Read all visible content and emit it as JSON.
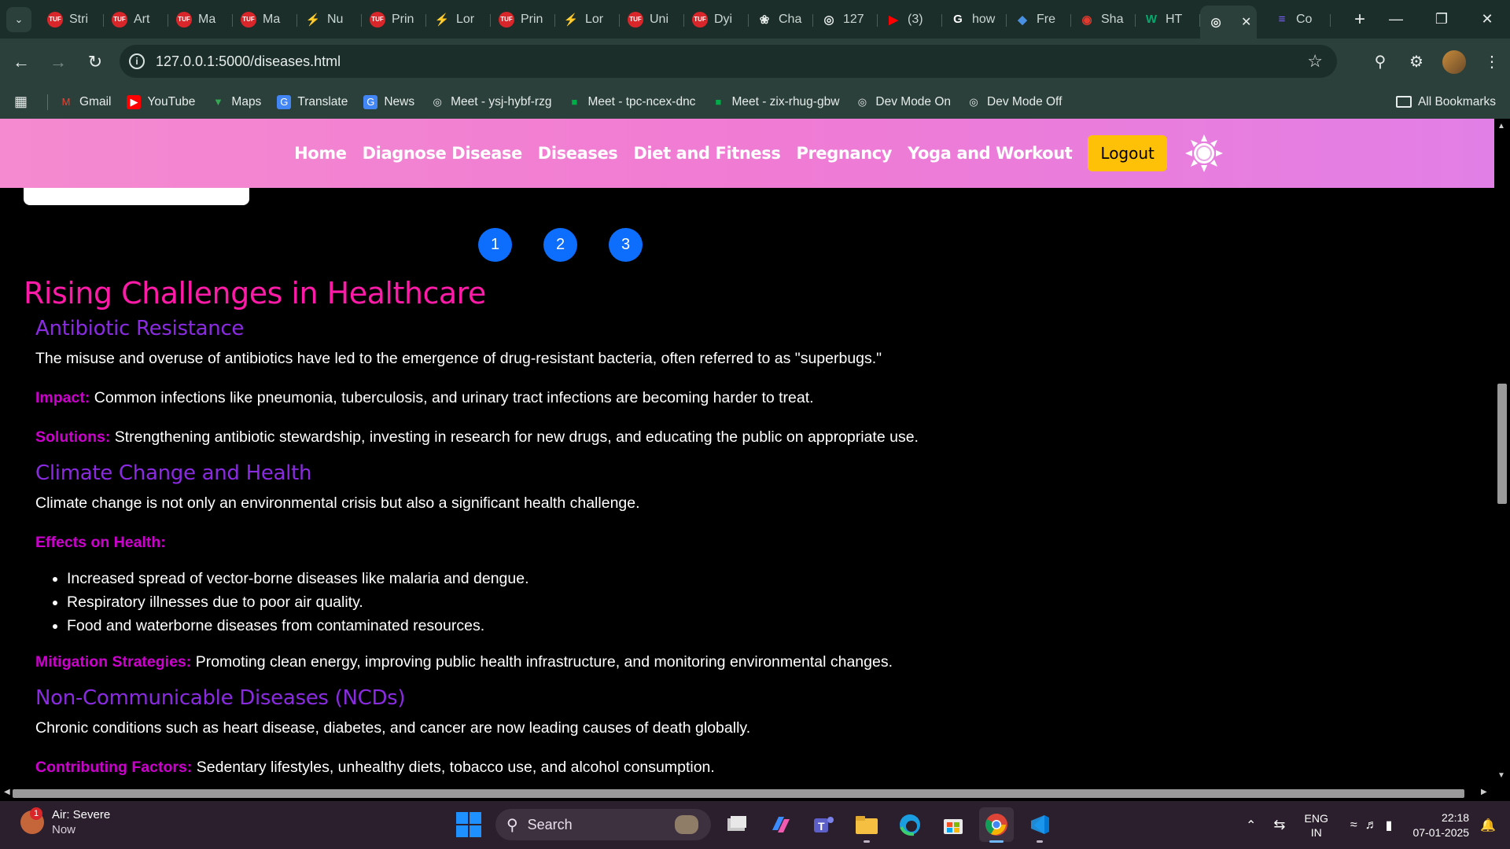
{
  "browser": {
    "tabs": [
      {
        "label": "Stri",
        "icon": "tuf-icon",
        "color": "#d9262a"
      },
      {
        "label": "Art",
        "icon": "tuf-icon",
        "color": "#d9262a"
      },
      {
        "label": "Ma",
        "icon": "tuf-icon",
        "color": "#d9262a"
      },
      {
        "label": "Ma",
        "icon": "tuf-icon",
        "color": "#d9262a"
      },
      {
        "label": "Nu",
        "icon": "bolt-icon",
        "color": "#f0a500"
      },
      {
        "label": "Prin",
        "icon": "tuf-icon",
        "color": "#d9262a"
      },
      {
        "label": "Lor",
        "icon": "bolt-icon",
        "color": "#f0a500"
      },
      {
        "label": "Prin",
        "icon": "tuf-icon",
        "color": "#d9262a"
      },
      {
        "label": "Lor",
        "icon": "bolt-icon",
        "color": "#f0a500"
      },
      {
        "label": "Uni",
        "icon": "tuf-icon",
        "color": "#d9262a"
      },
      {
        "label": "Dyi",
        "icon": "tuf-icon",
        "color": "#d9262a"
      },
      {
        "label": "Cha",
        "icon": "chatgpt-icon",
        "color": "#e6ecea"
      },
      {
        "label": "127",
        "icon": "globe-icon",
        "color": "#e6ecea"
      },
      {
        "label": "(3)",
        "icon": "youtube-icon",
        "color": "#ff0000"
      },
      {
        "label": "how",
        "icon": "google-icon",
        "color": "#ffffff"
      },
      {
        "label": "Fre",
        "icon": "gemini-icon",
        "color": "#4a90e2"
      },
      {
        "label": "Sha",
        "icon": "shadcn-icon",
        "color": "#e03a2f"
      },
      {
        "label": "HT",
        "icon": "w3schools-icon",
        "color": "#04aa6d"
      }
    ],
    "active_tab": {
      "icon": "globe-icon"
    },
    "last_tab": {
      "label": "Co",
      "icon": "docs-icon",
      "color": "#7b61ff"
    },
    "url": "127.0.0.1:5000/diseases.html",
    "bookmarks": [
      {
        "label": "Gmail",
        "icon": "gmail-icon"
      },
      {
        "label": "YouTube",
        "icon": "youtube-icon"
      },
      {
        "label": "Maps",
        "icon": "maps-icon"
      },
      {
        "label": "Translate",
        "icon": "translate-icon"
      },
      {
        "label": "News",
        "icon": "news-icon"
      },
      {
        "label": "Meet - ysj-hybf-rzg",
        "icon": "globe-icon"
      },
      {
        "label": "Meet - tpc-ncex-dnc",
        "icon": "meet-icon"
      },
      {
        "label": "Meet - zix-rhug-gbw",
        "icon": "meet-icon"
      },
      {
        "label": "Dev Mode On",
        "icon": "globe-icon"
      },
      {
        "label": "Dev Mode Off",
        "icon": "globe-icon"
      }
    ],
    "all_bookmarks": "All Bookmarks"
  },
  "site": {
    "nav": [
      "Home",
      "Diagnose Disease",
      "Diseases",
      "Diet and Fitness",
      "Pregnancy",
      "Yoga and Workout"
    ],
    "logout": "Logout",
    "pages": [
      "1",
      "2",
      "3"
    ]
  },
  "article": {
    "title": "Rising Challenges in Healthcare",
    "antibiotic": {
      "heading": "Antibiotic Resistance",
      "intro": "The misuse and overuse of antibiotics have led to the emergence of drug-resistant bacteria, often referred to as \"superbugs.\"",
      "impact_label": "Impact:",
      "impact_text": " Common infections like pneumonia, tuberculosis, and urinary tract infections are becoming harder to treat.",
      "solutions_label": "Solutions:",
      "solutions_text": " Strengthening antibiotic stewardship, investing in research for new drugs, and educating the public on appropriate use."
    },
    "climate": {
      "heading": "Climate Change and Health",
      "intro": "Climate change is not only an environmental crisis but also a significant health challenge.",
      "effects_label": "Effects on Health:",
      "effects": [
        "Increased spread of vector-borne diseases like malaria and dengue.",
        "Respiratory illnesses due to poor air quality.",
        "Food and waterborne diseases from contaminated resources."
      ],
      "mitigation_label": "Mitigation Strategies:",
      "mitigation_text": " Promoting clean energy, improving public health infrastructure, and monitoring environmental changes."
    },
    "ncd": {
      "heading": "Non-Communicable Diseases (NCDs)",
      "intro": "Chronic conditions such as heart disease, diabetes, and cancer are now leading causes of death globally.",
      "next_label": "Contributing Factors:",
      "next_text": " Sedentary lifestyles, unhealthy diets, tobacco use, and alcohol consumption."
    }
  },
  "taskbar": {
    "weather_title": "Air: Severe",
    "weather_sub": "Now",
    "weather_badge": "1",
    "search": "Search",
    "lang_1": "ENG",
    "lang_2": "IN",
    "time": "22:18",
    "date": "07-01-2025"
  },
  "colors": {
    "heading_pink": "#ff1aa8",
    "subheading_purple": "#8a2be2",
    "label_magenta": "#cc00cc",
    "logout_yellow": "#ffc107",
    "pager_blue": "#0d6efd"
  }
}
